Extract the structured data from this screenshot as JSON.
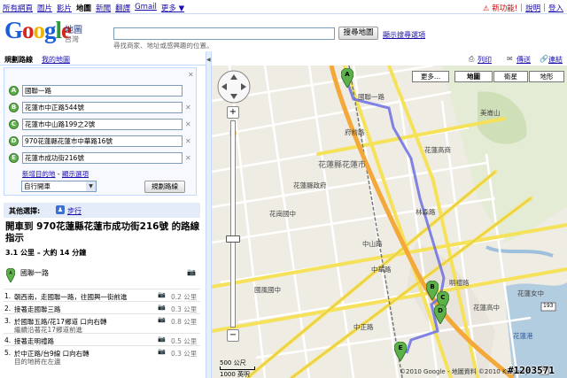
{
  "gbar": {
    "links": [
      "所有網頁",
      "圖片",
      "影片",
      "地圖",
      "新聞",
      "翻譯",
      "Gmail",
      "更多 ▼"
    ],
    "current": "地圖",
    "new_label": "新功能!",
    "new_icon": "alert-icon",
    "right_links": [
      "說明",
      "登入"
    ]
  },
  "header": {
    "logo": "Google",
    "logo_sub": "地圖",
    "logo_region": "台灣",
    "search_value": "",
    "search_hint": "尋找商家、地址或感興趣的位置。",
    "search_button": "搜尋地圖",
    "search_options": "顯示搜尋選項"
  },
  "sidebar": {
    "tab_active": "規劃路線",
    "tab_other": "我的地圖",
    "waypoints": [
      {
        "letter": "A",
        "value": "國聯一路"
      },
      {
        "letter": "B",
        "value": "花蓮市中正路544號"
      },
      {
        "letter": "C",
        "value": "花蓮市中山路199之2號"
      },
      {
        "letter": "D",
        "value": "970花蓮縣花蓮市中華路16號"
      },
      {
        "letter": "E",
        "value": "花蓮市成功街216號"
      }
    ],
    "add_destination": "新增目的地",
    "show_options": "顯示選項",
    "link_sep": " - ",
    "mode": "自行開車",
    "route_button": "規劃路線",
    "alt_label": "其他選擇:",
    "alt_walk": "步行",
    "route_title": "開車到 970花蓮縣花蓮市成功街216號 的路線指示",
    "route_summary": "3.1 公里 – 大約 14 分鐘",
    "start_label": "國聯一路",
    "steps": [
      {
        "num": "1.",
        "text": "朝西南，走國聯一路，往國興一街前進",
        "dist": "0.2 公里",
        "sub": ""
      },
      {
        "num": "2.",
        "text": "接著走國聯三路",
        "dist": "0.3 公里",
        "sub": ""
      },
      {
        "num": "3.",
        "text": "於國聯五路/花17鄉道 口向右轉",
        "dist": "0.8 公里",
        "sub": "繼續沿著花17鄉道前進"
      },
      {
        "num": "4.",
        "text": "接著走明禮路",
        "dist": "0.5 公里",
        "sub": ""
      },
      {
        "num": "5.",
        "text": "於中正路/台9線 口向右轉",
        "dist": "0.3 公里",
        "sub": "目的地將在左邊"
      }
    ]
  },
  "map": {
    "toolbar": [
      "列印",
      "傳送",
      "連結"
    ],
    "types": [
      "更多...",
      "地圖",
      "衛星",
      "地形"
    ],
    "selected_type": "地圖",
    "labels": [
      "花蓮縣花蓮市",
      "美崙山",
      "花蓮高商",
      "花蓮女中",
      "花蓮高中",
      "國風國中",
      "花崗國中",
      "花蓮縣政府",
      "中山路",
      "中華路",
      "林森路",
      "中正路",
      "明禮路",
      "國聯一路",
      "府前路",
      "花蓮港",
      "193",
      "9"
    ],
    "route_color": "#6b6fe3",
    "scale_top": "500 公尺",
    "scale_bottom": "1000 英呎",
    "copyright": "©2010 Google - 地圖資料 ©2010 Kingway",
    "watermark": "#1203571"
  }
}
